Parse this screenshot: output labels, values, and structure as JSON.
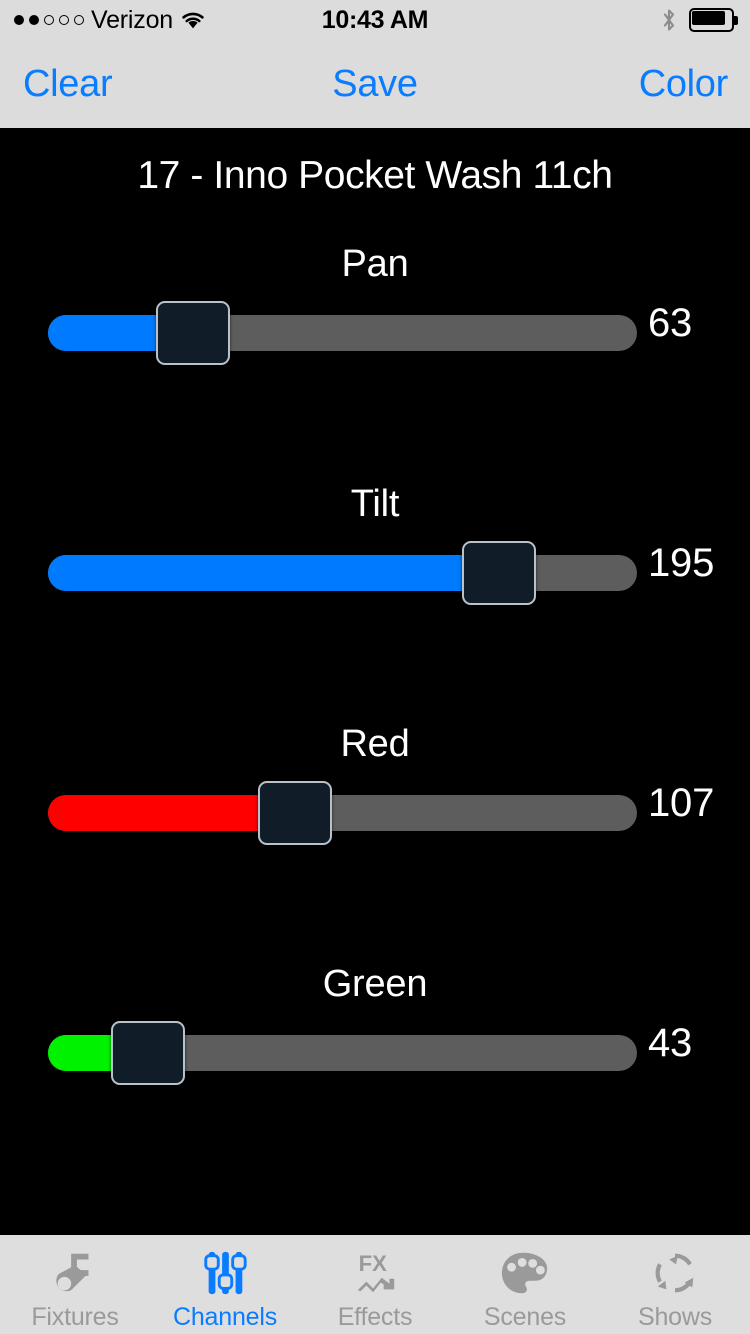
{
  "status_bar": {
    "signal_dots_filled": 2,
    "signal_dots_total": 5,
    "carrier": "Verizon",
    "wifi_icon": "wifi-icon",
    "time": "10:43 AM",
    "bluetooth_icon": "bluetooth-icon",
    "battery_icon": "battery-icon",
    "battery_level_pct": 80
  },
  "nav_bar": {
    "clear_label": "Clear",
    "save_label": "Save",
    "color_label": "Color",
    "tint_color": "#0a7cff",
    "background": "#dcdcdc"
  },
  "main": {
    "fixture_title": "17 - Inno Pocket Wash 11ch",
    "background": "#000000",
    "slider_min": 0,
    "slider_max": 255,
    "track_color": "#5d5d5d",
    "thumb_color": "#101c28",
    "thumb_border_color": "#b9c2c9",
    "channels": [
      {
        "label": "Pan",
        "value": 63,
        "fill_color": "#007aff",
        "fill_pct": 24.7
      },
      {
        "label": "Tilt",
        "value": 195,
        "fill_color": "#007aff",
        "fill_pct": 76.5
      },
      {
        "label": "Red",
        "value": 107,
        "fill_color": "#fe0000",
        "fill_pct": 42.0
      },
      {
        "label": "Green",
        "value": 43,
        "fill_color": "#00f200",
        "fill_pct": 16.9
      }
    ]
  },
  "tab_bar": {
    "background": "#dedede",
    "active_color": "#0a7cff",
    "inactive_color": "#9a9a9a",
    "items": [
      {
        "label": "Fixtures",
        "icon": "stage-light-icon",
        "active": false
      },
      {
        "label": "Channels",
        "icon": "vertical-sliders-icon",
        "active": true
      },
      {
        "label": "Effects",
        "icon": "fx-graph-icon",
        "active": false
      },
      {
        "label": "Scenes",
        "icon": "paint-palette-icon",
        "active": false
      },
      {
        "label": "Shows",
        "icon": "loop-arrows-icon",
        "active": false
      }
    ]
  }
}
